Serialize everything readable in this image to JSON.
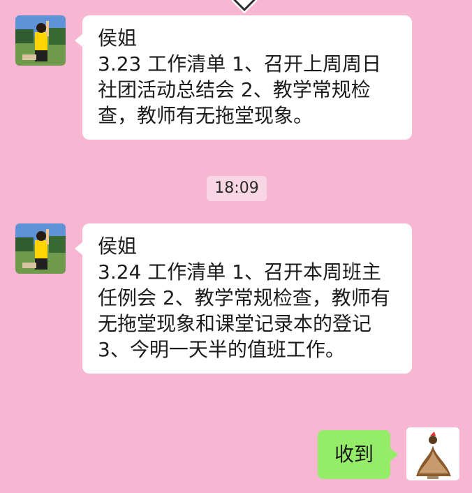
{
  "messages": [
    {
      "side": "left",
      "sender": "侯姐",
      "text": "3.23 工作清单 1、召开上周周日社团活动总结会 2、教学常规检查，教师有无拖堂现象。"
    },
    {
      "side": "left",
      "sender": "侯姐",
      "text": "3.24 工作清单 1、召开本周班主任例会 2、教学常规检查，教师有无拖堂现象和课堂记录本的登记 3、今明一天半的值班工作。"
    },
    {
      "side": "right",
      "text": "收到"
    }
  ],
  "timestamp": "18:09",
  "icons": {
    "top_arrow": "chevron-down-icon",
    "left_avatar": "avatar-outdoor-photo",
    "right_avatar": "avatar-figure-photo"
  },
  "colors": {
    "background": "#f7b6d1",
    "incoming_bubble": "#ffffff",
    "outgoing_bubble": "#95ec69",
    "timestamp_bg": "#f9d6e4"
  }
}
